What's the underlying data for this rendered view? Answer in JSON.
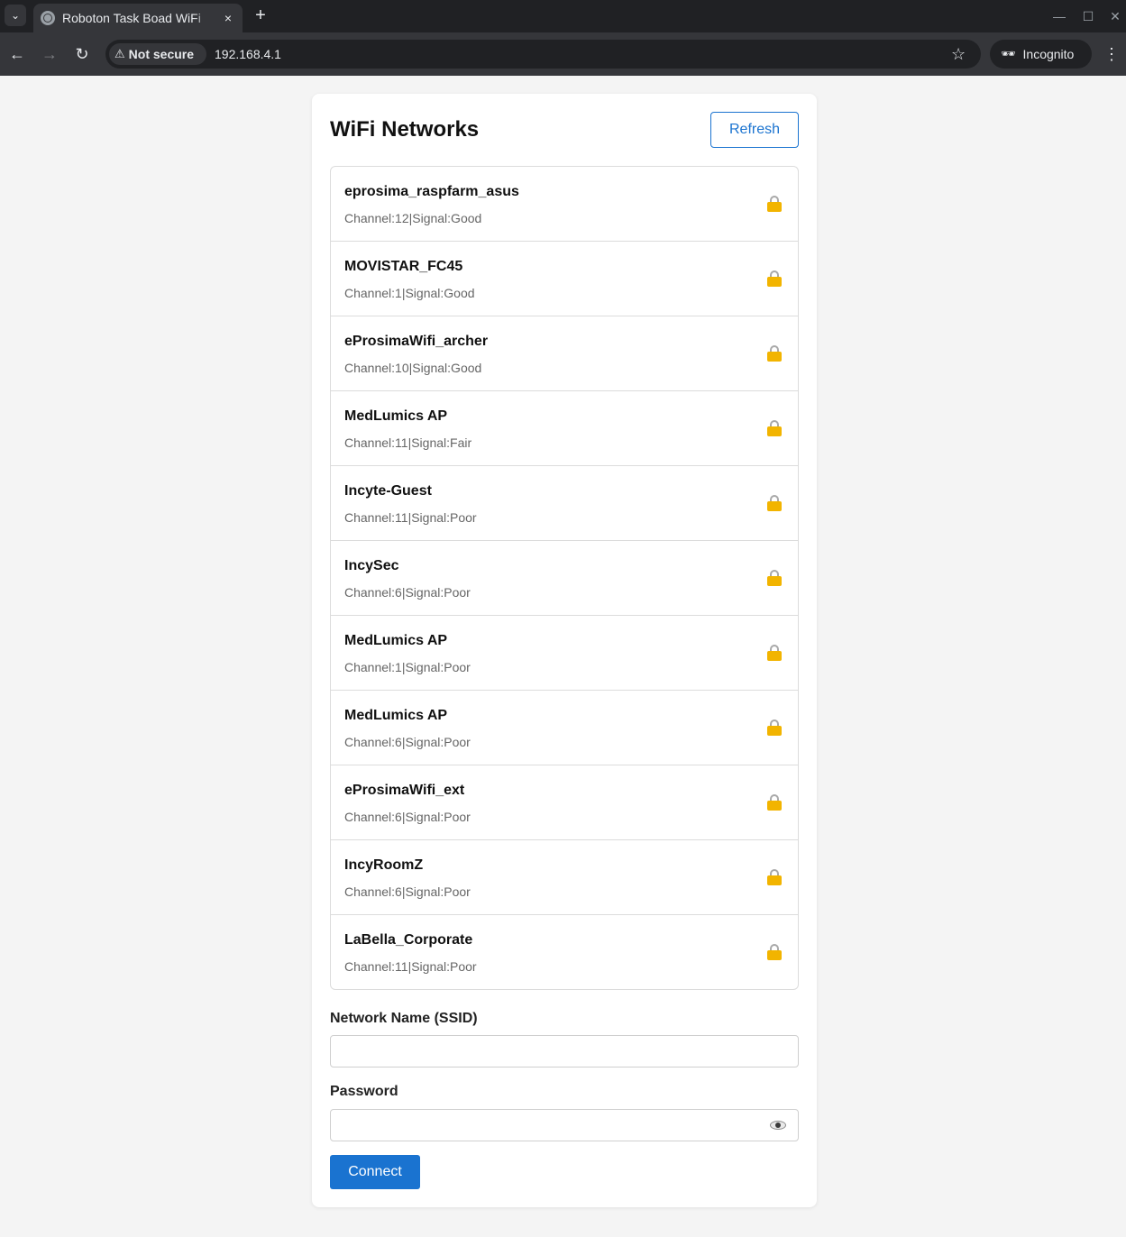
{
  "browser": {
    "tab_title": "Roboton Task Boad WiFi",
    "tab_close": "×",
    "new_tab": "+",
    "security_label": "Not secure",
    "url": "192.168.4.1",
    "incognito_label": "Incognito",
    "window_controls": {
      "minimize": "—",
      "maximize": "☐",
      "close": "✕"
    },
    "nav": {
      "back": "←",
      "forward": "→",
      "reload": "↻",
      "menu": "⋮",
      "bookmark": "☆",
      "tab_menu": "⌄"
    }
  },
  "page": {
    "title": "WiFi Networks",
    "refresh_label": "Refresh",
    "networks": [
      {
        "ssid": "eprosima_raspfarm_asus",
        "details": "Channel:12|Signal:Good",
        "secured": true
      },
      {
        "ssid": "MOVISTAR_FC45",
        "details": "Channel:1|Signal:Good",
        "secured": true
      },
      {
        "ssid": "eProsimaWifi_archer",
        "details": "Channel:10|Signal:Good",
        "secured": true
      },
      {
        "ssid": "MedLumics AP",
        "details": "Channel:11|Signal:Fair",
        "secured": true
      },
      {
        "ssid": "Incyte-Guest",
        "details": "Channel:11|Signal:Poor",
        "secured": true
      },
      {
        "ssid": "IncySec",
        "details": "Channel:6|Signal:Poor",
        "secured": true
      },
      {
        "ssid": "MedLumics AP",
        "details": "Channel:1|Signal:Poor",
        "secured": true
      },
      {
        "ssid": "MedLumics AP",
        "details": "Channel:6|Signal:Poor",
        "secured": true
      },
      {
        "ssid": "eProsimaWifi_ext",
        "details": "Channel:6|Signal:Poor",
        "secured": true
      },
      {
        "ssid": "IncyRoomZ",
        "details": "Channel:6|Signal:Poor",
        "secured": true
      },
      {
        "ssid": "LaBella_Corporate",
        "details": "Channel:11|Signal:Poor",
        "secured": true
      }
    ],
    "ssid_label": "Network Name (SSID)",
    "ssid_value": "",
    "password_label": "Password",
    "password_value": "",
    "connect_label": "Connect"
  },
  "colors": {
    "accent": "#1a73d0",
    "page_background": "#f4f4f4",
    "lock": "#f2b400"
  }
}
